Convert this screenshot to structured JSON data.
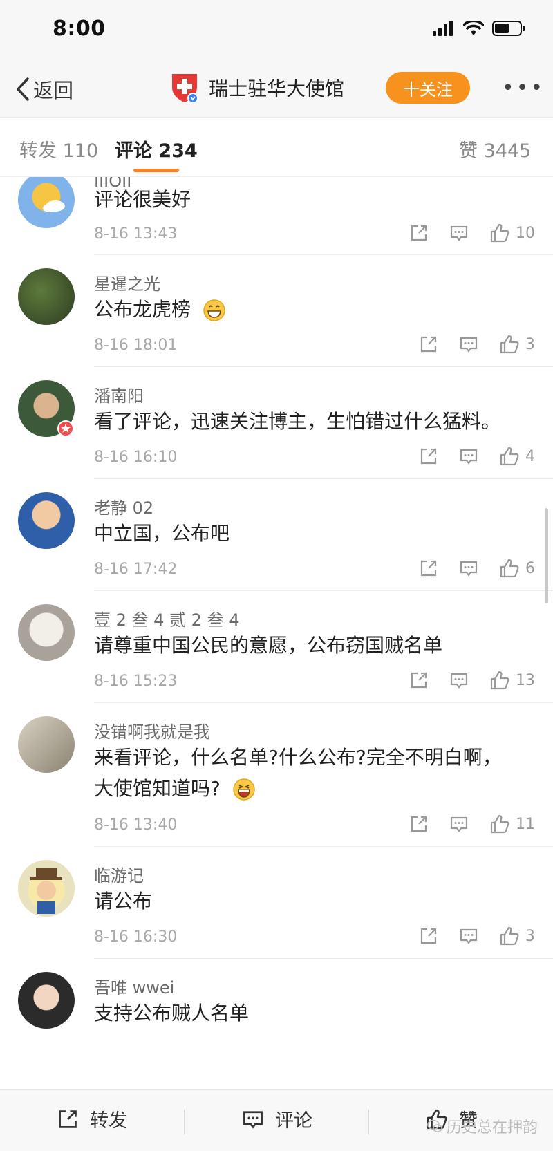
{
  "status_bar": {
    "time": "8:00"
  },
  "nav": {
    "back_label": "返回",
    "title": "瑞士驻华大使馆",
    "follow_label": "十关注",
    "more_label": "•••"
  },
  "tabs": {
    "repost": {
      "label": "转发",
      "count": "110"
    },
    "comment": {
      "label": "评论",
      "count": "234"
    },
    "like": {
      "label": "赞",
      "count": "3445"
    }
  },
  "comments": [
    {
      "username": "IIIOII",
      "text": "评论很美好",
      "date": "8-16 13:43",
      "likes": "10"
    },
    {
      "username": "星暹之光",
      "text": "公布龙虎榜",
      "date": "8-16 18:01",
      "likes": "3"
    },
    {
      "username": "潘南阳",
      "text": "看了评论，迅速关注博主，生怕错过什么猛料。",
      "date": "8-16 16:10",
      "likes": "4"
    },
    {
      "username": "老静 02",
      "text": "中立国，公布吧",
      "date": "8-16 17:42",
      "likes": "6"
    },
    {
      "username": "壹 2 叁 4 贰 2 叁 4",
      "text": "请尊重中国公民的意愿，公布窃国贼名单",
      "date": "8-16 15:23",
      "likes": "13"
    },
    {
      "username": "没错啊我就是我",
      "text": "来看评论，什么名单?什么公布?完全不明白啊，",
      "text2": "大使馆知道吗?",
      "date": "8-16 13:40",
      "likes": "11"
    },
    {
      "username": "临游记",
      "text": "请公布",
      "date": "8-16 16:30",
      "likes": "3"
    },
    {
      "username": "吾唯 wwei",
      "text": "支持公布贼人名单"
    }
  ],
  "bottom_bar": {
    "repost_label": "转发",
    "comment_label": "评论",
    "like_label": "赞",
    "watermark": "历史总在押韵"
  },
  "colors": {
    "accent": "#f8921f",
    "tab_underline": "#f8821f",
    "meta_gray": "#a8a8a8"
  }
}
